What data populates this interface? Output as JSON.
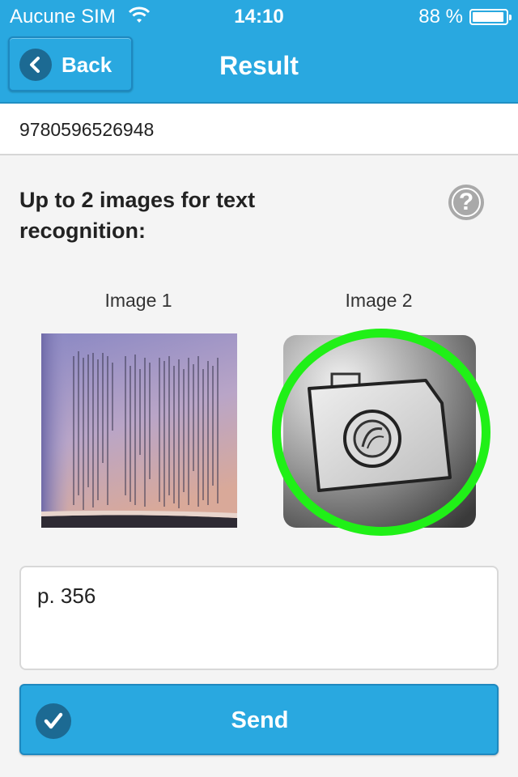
{
  "status_bar": {
    "carrier": "Aucune SIM",
    "time": "14:10",
    "battery_pct": "88 %",
    "wifi_icon": "wifi-icon",
    "battery_icon": "battery-icon"
  },
  "nav": {
    "back_label": "Back",
    "back_icon": "chevron-left-icon",
    "title": "Result"
  },
  "isbn": "9780596526948",
  "heading": "Up to 2 images for text recognition:",
  "help_icon": "question-icon",
  "images": [
    {
      "label": "Image 1",
      "content": "photo-of-book-page"
    },
    {
      "label": "Image 2",
      "content": "camera-icon",
      "highlighted": true
    }
  ],
  "note": {
    "value": "p. 356"
  },
  "send": {
    "label": "Send",
    "icon": "checkmark-icon"
  },
  "colors": {
    "accent": "#29a8e0",
    "accent_dark": "#1c6a93",
    "highlight_ring": "#20f017",
    "background": "#f4f4f4"
  }
}
